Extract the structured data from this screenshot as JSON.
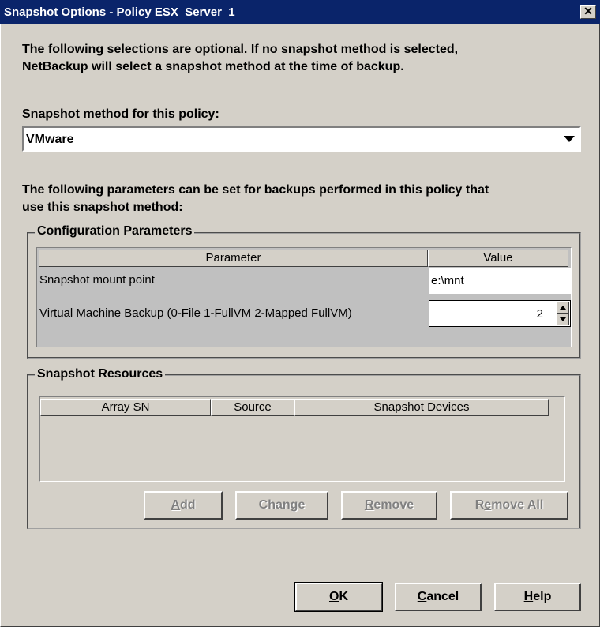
{
  "window": {
    "title": "Snapshot Options - Policy ESX_Server_1",
    "close_glyph": "✕"
  },
  "intro": {
    "line1": "The following selections are optional. If no snapshot method is selected,",
    "line2": "NetBackup will select a snapshot method at the time of backup."
  },
  "method": {
    "label": "Snapshot method for this policy:",
    "selected": "VMware",
    "icon": "chevron-down-icon"
  },
  "params_intro": {
    "line1": "The following parameters can be set for backups performed in this policy that",
    "line2": "use this snapshot method:"
  },
  "config": {
    "legend": "Configuration Parameters",
    "columns": [
      "Parameter",
      "Value"
    ],
    "rows": [
      {
        "parameter": "Snapshot mount point",
        "value": "e:\\mnt"
      },
      {
        "parameter": "Virtual Machine Backup (0-File 1-FullVM 2-Mapped FullVM)",
        "value": "2"
      }
    ]
  },
  "resources": {
    "legend": "Snapshot Resources",
    "columns": [
      "Array SN",
      "Source",
      "Snapshot Devices"
    ],
    "buttons": {
      "add": {
        "prefix": "",
        "mnemonic": "A",
        "suffix": "dd"
      },
      "change": {
        "prefix": "Chan",
        "mnemonic": "g",
        "suffix": "e"
      },
      "remove": {
        "prefix": "",
        "mnemonic": "R",
        "suffix": "emove"
      },
      "remove_all": {
        "prefix": "R",
        "mnemonic": "e",
        "suffix": "move All"
      }
    }
  },
  "footer": {
    "ok": {
      "mnemonic": "O",
      "suffix": "K"
    },
    "cancel": {
      "mnemonic": "C",
      "suffix": "ancel"
    },
    "help": {
      "mnemonic": "H",
      "suffix": "elp"
    }
  }
}
